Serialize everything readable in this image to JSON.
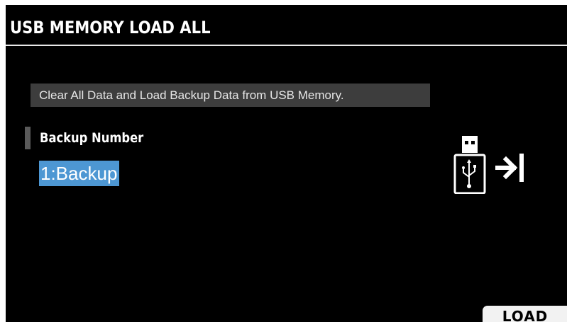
{
  "title_bar": {
    "title": "USB MEMORY LOAD ALL"
  },
  "message": {
    "text": "Clear All Data and Load Backup Data from USB Memory."
  },
  "parameter": {
    "label": "Backup Number",
    "value": "1:Backup",
    "highlight_color": "#4d97d3"
  },
  "icons": {
    "usb": "usb-memory-icon",
    "arrow": "arrow-into-icon"
  },
  "function_buttons": {
    "load_label": "LOAD"
  }
}
